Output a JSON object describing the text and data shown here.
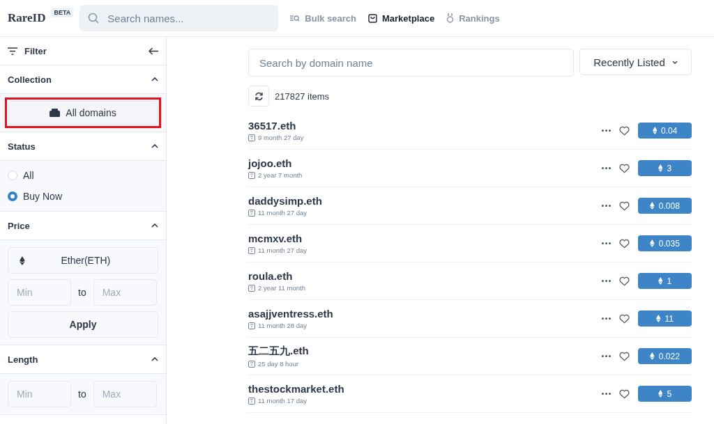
{
  "header": {
    "logo": "RareID",
    "badge": "BETA",
    "search": {
      "placeholder": "Search names..."
    },
    "nav": [
      {
        "label": "Bulk search",
        "kind": "bulk",
        "selected": false
      },
      {
        "label": "Marketplace",
        "kind": "market",
        "selected": true
      },
      {
        "label": "Rankings",
        "kind": "rank",
        "selected": false
      }
    ]
  },
  "sidebar": {
    "title": "Filter",
    "collection": {
      "title": "Collection",
      "expanded": true,
      "button": "All domains",
      "highlighted": true
    },
    "status": {
      "title": "Status",
      "expanded": true,
      "options": [
        {
          "label": "All",
          "selected": false
        },
        {
          "label": "Buy Now",
          "selected": true
        }
      ]
    },
    "price": {
      "title": "Price",
      "expanded": true,
      "currency": "Ether(ETH)",
      "min": {
        "placeholder": "Min"
      },
      "to": "to",
      "max": {
        "placeholder": "Max"
      },
      "apply": "Apply"
    },
    "length": {
      "title": "Length",
      "expanded": true,
      "min": {
        "placeholder": "Min"
      },
      "to": "to",
      "max": {
        "placeholder": "Max"
      }
    }
  },
  "main": {
    "search": {
      "placeholder": "Search by domain name"
    },
    "sort": "Recently Listed",
    "count": "217827 items",
    "rows": [
      {
        "name": "36517.eth",
        "age": "9 month 27 day",
        "price": "0.04"
      },
      {
        "name": "jojoo.eth",
        "age": "2 year 7 month",
        "price": "3"
      },
      {
        "name": "daddysimp.eth",
        "age": "11 month 27 day",
        "price": "0.008"
      },
      {
        "name": "mcmxv.eth",
        "age": "11 month 27 day",
        "price": "0.035"
      },
      {
        "name": "roula.eth",
        "age": "2 year 11 month",
        "price": "1"
      },
      {
        "name": "asajjventress.eth",
        "age": "11 month 28 day",
        "price": "11"
      },
      {
        "name": "五二五九.eth",
        "age": "25 day 8 hour",
        "price": "0.022"
      },
      {
        "name": "thestockmarket.eth",
        "age": "11 month 17 day",
        "price": "5"
      }
    ]
  }
}
